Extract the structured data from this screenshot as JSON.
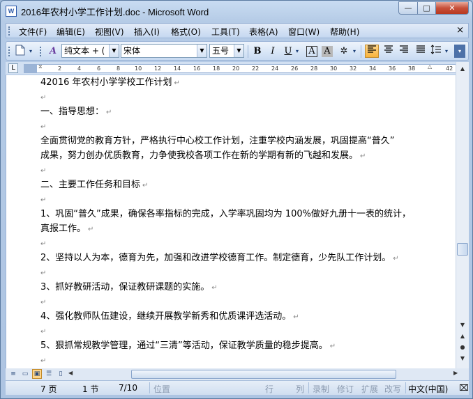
{
  "window": {
    "title": "2016年农村小学工作计划.doc - Microsoft Word",
    "app_icon_letter": "W",
    "minimize_glyph": "—",
    "maximize_glyph": "□",
    "close_glyph": "✕"
  },
  "menubar": {
    "items": [
      "文件(F)",
      "编辑(E)",
      "视图(V)",
      "插入(I)",
      "格式(O)",
      "工具(T)",
      "表格(A)",
      "窗口(W)",
      "帮助(H)"
    ],
    "close_glyph": "×"
  },
  "toolbar": {
    "style_value": "纯文本 + (",
    "font_value": "宋体",
    "size_value": "五号",
    "bold": "B",
    "italic": "I",
    "underline": "U",
    "char_border": "A",
    "char_shading": "A",
    "accent_color": "#f8b33c"
  },
  "ruler": {
    "numbers": [
      "2",
      "4",
      "6",
      "8",
      "10",
      "12",
      "14",
      "16",
      "18",
      "20",
      "22",
      "24",
      "26",
      "28",
      "30",
      "32",
      "34",
      "36",
      "38",
      "42"
    ]
  },
  "document": {
    "paragraphs": [
      "42016 年农村小学学校工作计划",
      "",
      "一、指导思想：",
      "",
      "全面贯彻党的教育方针，严格执行中心校工作计划，注重学校内涵发展，巩固提高“普久”",
      "成果，努力创办优质教育，力争使我校各项工作在新的学期有新的飞越和发展。",
      "",
      "二、主要工作任务和目标",
      "",
      "1、巩固“普久”成果，确保各率指标的完成，入学率巩固均为 100%做好九册十一表的统计，",
      "真报工作。",
      "",
      "2、坚持以人为本，德育为先，加强和改进学校德育工作。制定德育，少先队工作计划。",
      "",
      "3、抓好教研活动，保证教研课题的实施。",
      "",
      "4、强化教师队伍建设，继续开展教学新秀和优质课评选活动。",
      "",
      "5、狠抓常规教学管理，通过“三清”等活动，保证教学质量的稳步提高。"
    ],
    "paragraph_mark": "↵"
  },
  "statusbar": {
    "page": "7 页",
    "section": "1 节",
    "page_of": "7/10",
    "position": "位置",
    "line": "行",
    "column": "列",
    "record": "录制",
    "revise": "修订",
    "extend": "扩展",
    "overtype": "改写",
    "language": "中文(中国)"
  }
}
